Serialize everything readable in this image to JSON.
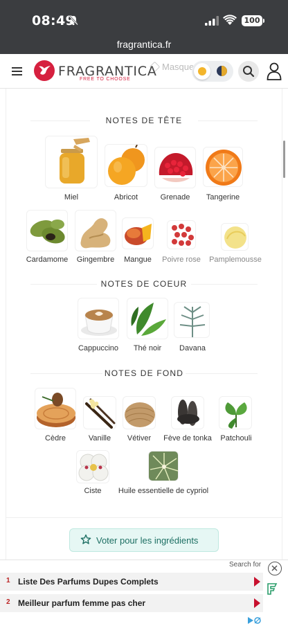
{
  "status_bar": {
    "time": "08:49",
    "battery": "100"
  },
  "browser": {
    "url": "fragrantica.fr"
  },
  "header": {
    "logo_text": "FRAGRANTICA",
    "tagline": "FREE TO CHOOSE",
    "ghost_nav_text": "Masque"
  },
  "sections": {
    "top": {
      "title": "NOTES DE TÊTE",
      "notes": [
        {
          "label": "Miel"
        },
        {
          "label": "Abricot"
        },
        {
          "label": "Grenade"
        },
        {
          "label": "Tangerine"
        },
        {
          "label": "Cardamome"
        },
        {
          "label": "Gingembre"
        },
        {
          "label": "Mangue"
        },
        {
          "label": "Poivre rose"
        },
        {
          "label": "Pamplemousse"
        }
      ]
    },
    "heart": {
      "title": "NOTES DE COEUR",
      "notes": [
        {
          "label": "Cappuccino"
        },
        {
          "label": "Thé noir"
        },
        {
          "label": "Davana"
        }
      ]
    },
    "base": {
      "title": "NOTES DE FOND",
      "notes": [
        {
          "label": "Cèdre"
        },
        {
          "label": "Vanille"
        },
        {
          "label": "Vétiver"
        },
        {
          "label": "Fève de tonka"
        },
        {
          "label": "Patchouli"
        },
        {
          "label": "Ciste"
        },
        {
          "label": "Huile essentielle de cypriol"
        }
      ]
    }
  },
  "vote_button": {
    "label": "Voter pour les ingrédients"
  },
  "ad": {
    "search_for": "Search for",
    "results": [
      {
        "num": "1",
        "text": "Liste Des Parfums Dupes Complets"
      },
      {
        "num": "2",
        "text": "Meilleur parfum femme pas cher"
      }
    ]
  },
  "colors": {
    "brand": "#d6203f",
    "vote_bg": "#e6f7f4",
    "vote_text": "#1d6f63",
    "status_bar_bg": "#3b3d40"
  }
}
